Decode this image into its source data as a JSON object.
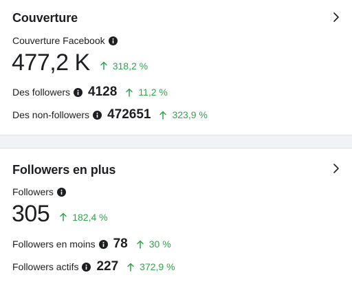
{
  "reach": {
    "title": "Couverture",
    "subtitle": "Couverture Facebook",
    "total": "477,2 K",
    "total_change": "318,2 %",
    "followers_label": "Des followers",
    "followers_value": "4128",
    "followers_change": "11,2 %",
    "non_followers_label": "Des non-followers",
    "non_followers_value": "472651",
    "non_followers_change": "323,9 %"
  },
  "follows": {
    "title": "Followers en plus",
    "subtitle": "Followers",
    "total": "305",
    "total_change": "182,4 %",
    "unfollows_label": "Followers en moins",
    "unfollows_value": "78",
    "unfollows_change": "30 %",
    "active_label": "Followers actifs",
    "active_value": "227",
    "active_change": "372,9 %"
  },
  "colors": {
    "positive": "#31a24c",
    "text": "#1c1e21",
    "background": "#f0f2f5"
  },
  "icons": [
    "chevron-right-icon",
    "info-icon",
    "arrow-up-icon"
  ]
}
